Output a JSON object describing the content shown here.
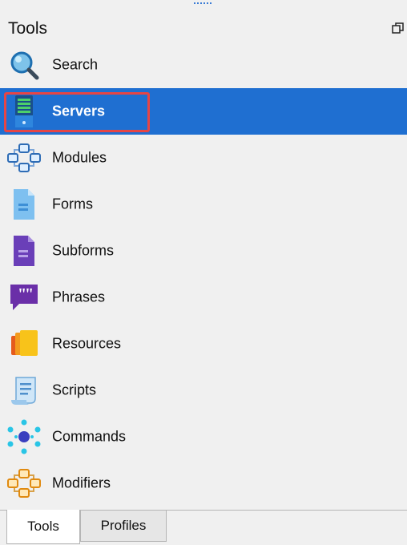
{
  "panel": {
    "title": "Tools",
    "restore_icon": "restore-window-icon"
  },
  "items": [
    {
      "label": "Search",
      "icon": "search-icon"
    },
    {
      "label": "Servers",
      "icon": "server-icon",
      "selected": true
    },
    {
      "label": "Modules",
      "icon": "modules-icon"
    },
    {
      "label": "Forms",
      "icon": "form-icon"
    },
    {
      "label": "Subforms",
      "icon": "subform-icon"
    },
    {
      "label": "Phrases",
      "icon": "phrase-icon"
    },
    {
      "label": "Resources",
      "icon": "resources-icon"
    },
    {
      "label": "Scripts",
      "icon": "script-icon"
    },
    {
      "label": "Commands",
      "icon": "commands-icon"
    },
    {
      "label": "Modifiers",
      "icon": "modifiers-icon"
    }
  ],
  "tabs": [
    {
      "label": "Tools",
      "active": true
    },
    {
      "label": "Profiles",
      "active": false
    }
  ],
  "colors": {
    "selection": "#1f6fd1",
    "highlight_border": "#e64545",
    "panel_bg": "#f0f0f0"
  }
}
